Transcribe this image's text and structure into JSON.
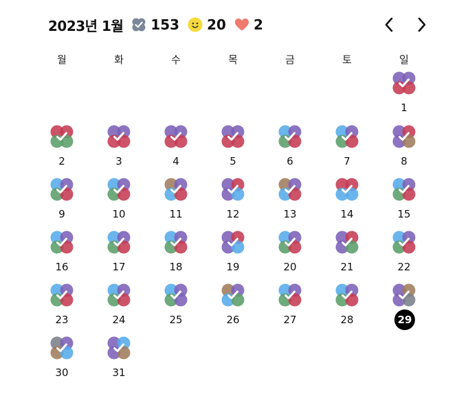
{
  "header": {
    "title": "2023년 1월",
    "stats": [
      {
        "icon": "check-badge-icon",
        "value": "153",
        "color": "#7C8899"
      },
      {
        "icon": "smiley-icon",
        "value": "20",
        "color": "#F7D93C"
      },
      {
        "icon": "heart-icon",
        "value": "2",
        "color": "#EF7A6E"
      }
    ]
  },
  "colors": {
    "purple": "#7C61B8",
    "red": "#C53B53",
    "green": "#5B9E6A",
    "blue": "#56ABEA",
    "brown": "#A07C5C",
    "gray": "#7A7F8A"
  },
  "weekdays": [
    "월",
    "화",
    "수",
    "목",
    "금",
    "토",
    "일"
  ],
  "start_weekday_index": 6,
  "today": 29,
  "days": [
    {
      "day": "1",
      "c": [
        "purple",
        "purple",
        "red",
        "red"
      ]
    },
    {
      "day": "2",
      "c": [
        "red",
        "red",
        "green",
        "green"
      ]
    },
    {
      "day": "3",
      "c": [
        "purple",
        "purple",
        "red",
        "red"
      ]
    },
    {
      "day": "4",
      "c": [
        "purple",
        "purple",
        "red",
        "red"
      ]
    },
    {
      "day": "5",
      "c": [
        "purple",
        "purple",
        "red",
        "red"
      ]
    },
    {
      "day": "6",
      "c": [
        "blue",
        "purple",
        "green",
        "red"
      ]
    },
    {
      "day": "7",
      "c": [
        "blue",
        "purple",
        "green",
        "red"
      ]
    },
    {
      "day": "8",
      "c": [
        "purple",
        "red",
        "purple",
        "brown"
      ]
    },
    {
      "day": "9",
      "c": [
        "blue",
        "purple",
        "green",
        "red"
      ]
    },
    {
      "day": "10",
      "c": [
        "blue",
        "purple",
        "green",
        "red"
      ]
    },
    {
      "day": "11",
      "c": [
        "brown",
        "purple",
        "blue",
        "red"
      ]
    },
    {
      "day": "12",
      "c": [
        "purple",
        "red",
        "purple",
        "blue"
      ]
    },
    {
      "day": "13",
      "c": [
        "brown",
        "purple",
        "blue",
        "red"
      ]
    },
    {
      "day": "14",
      "c": [
        "red",
        "red",
        "blue",
        "blue"
      ]
    },
    {
      "day": "15",
      "c": [
        "blue",
        "purple",
        "green",
        "red"
      ]
    },
    {
      "day": "16",
      "c": [
        "blue",
        "purple",
        "green",
        "red"
      ]
    },
    {
      "day": "17",
      "c": [
        "blue",
        "purple",
        "green",
        "red"
      ]
    },
    {
      "day": "18",
      "c": [
        "blue",
        "purple",
        "green",
        "red"
      ]
    },
    {
      "day": "19",
      "c": [
        "purple",
        "red",
        "purple",
        "blue"
      ]
    },
    {
      "day": "20",
      "c": [
        "blue",
        "purple",
        "green",
        "red"
      ]
    },
    {
      "day": "21",
      "c": [
        "purple",
        "red",
        "purple",
        "green"
      ]
    },
    {
      "day": "22",
      "c": [
        "blue",
        "purple",
        "green",
        "red"
      ]
    },
    {
      "day": "23",
      "c": [
        "blue",
        "purple",
        "green",
        "red"
      ]
    },
    {
      "day": "24",
      "c": [
        "blue",
        "purple",
        "green",
        "red"
      ]
    },
    {
      "day": "25",
      "c": [
        "blue",
        "purple",
        "green",
        "purple"
      ]
    },
    {
      "day": "26",
      "c": [
        "brown",
        "purple",
        "blue",
        "green"
      ]
    },
    {
      "day": "27",
      "c": [
        "blue",
        "purple",
        "green",
        "red"
      ]
    },
    {
      "day": "28",
      "c": [
        "blue",
        "purple",
        "green",
        "red"
      ]
    },
    {
      "day": "29",
      "c": [
        "purple",
        "brown",
        "purple",
        "gray"
      ]
    },
    {
      "day": "30",
      "c": [
        "gray",
        "purple",
        "brown",
        "blue"
      ]
    },
    {
      "day": "31",
      "c": [
        "purple",
        "blue",
        "purple",
        "brown"
      ]
    }
  ]
}
